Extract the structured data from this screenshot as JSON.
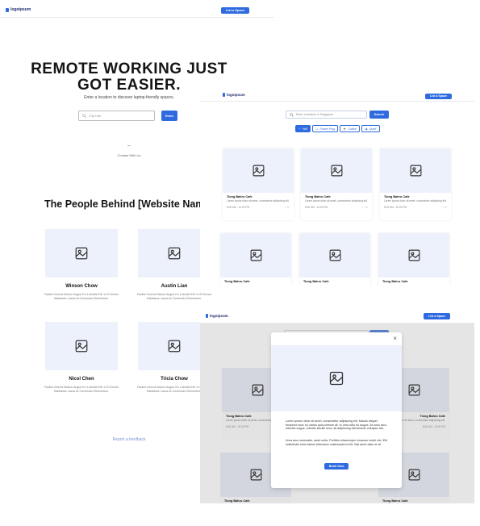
{
  "logo": {
    "text": "logoipsum",
    "suffix": "°"
  },
  "list_space_label": "List a Space",
  "landing": {
    "hero_line1": "REMOTE WORKING JUST",
    "hero_line2": "GOT EASIER.",
    "subtitle": "Enter a location to discover laptop-friendly spaces.",
    "city_placeholder": "City Hall",
    "enter_label": "Enter",
    "contact": "Contact With Us",
    "people_heading": "The People Behind [Website Name]",
    "team": [
      {
        "name": "Winson Chow",
        "desc": "Facilisi Viverra Dictum Augue Eu Lobortis Elit. In Et Donec Habitasse Lacus At Commodo Elementum."
      },
      {
        "name": "Austin Lian",
        "desc": "Facilisi Viverra Dictum Augue Eu Lobortis Elit. In Et Donec Habitasse Lacus At Commodo Elementum."
      },
      {
        "name": "Nicol Chen",
        "desc": "Facilisi Viverra Dictum Augue Eu Lobortis Elit. In Et Donec Habitasse Lacus At Commodo Elementum."
      },
      {
        "name": "Tricia Chow",
        "desc": "Facilisi Viverra Dictum Augue Eu Lobortis Elit. In Et Donec Habitasse Lacus At Commodo Elementum."
      }
    ],
    "feedback": "Report a feedback"
  },
  "search_page": {
    "placeholder": "Enter a location in Singapore",
    "search_label": "Search",
    "filters": [
      {
        "label": "Wifi",
        "icon": "wifi-icon",
        "active": true
      },
      {
        "label": "Power Plug",
        "icon": "plug-icon",
        "active": false
      },
      {
        "label": "Coffee",
        "icon": "coffee-icon",
        "active": false
      },
      {
        "label": "Quiet",
        "icon": "quiet-icon",
        "active": false
      }
    ],
    "cards": [
      {
        "title": "Tiong Bahru Cafe",
        "desc": "Lorem ipsum dolor sit amet, consectetur adipiscing elit.",
        "hours": "8:00 AM - 10:00 PM"
      },
      {
        "title": "Tiong Bahru Cafe",
        "desc": "Lorem ipsum dolor sit amet, consectetur adipiscing elit.",
        "hours": "8:00 AM - 10:00 PM"
      },
      {
        "title": "Tiong Bahru Cafe",
        "desc": "Lorem ipsum dolor sit amet, consectetur adipiscing elit.",
        "hours": "8:00 AM - 10:00 PM"
      },
      {
        "title": "Tiong Bahru Cafe"
      },
      {
        "title": "Tiong Bahru Cafe"
      },
      {
        "title": "Tiong Bahru Cafe"
      }
    ]
  },
  "modal_page": {
    "close": "×",
    "para1": "Lorem ipsum dolor sit amet, consectetur adipiscing elit. Mauris aliquet tincidunt nunc eu varius quis pretium sit. In urna odio eu augue. At nunc arcu ultricies augue, lobortis iaculis urna, sit adipiscing elementum volutpat. Aut.",
    "para2": "Urna arcu venenatis, amet nulla. Porttitor ullamcorper vivamus morbi nisi. Elit sollicitudin enim fames bibendum malesuada id elit. Nisi amet diam et at.",
    "book_label": "Book Now",
    "bg_cards": [
      {
        "title": "Tiong Bahru Cafe",
        "desc": "Lorem ipsum dolor sit amet, consectetur adipiscing elit.",
        "hours": "8:00 AM - 10:00 PM"
      },
      {
        "title": "Tiong Bahru Cafe",
        "desc": "Lorem ipsum dolor sit amet, consectetur adipiscing elit.",
        "hours": "8:00 AM - 10:00 PM"
      },
      {
        "title": "Tiong Bahru Cafe"
      },
      {
        "title": "Tiong Bahru Cafe"
      }
    ]
  },
  "colors": {
    "accent": "#2f6bdf",
    "placeholder_bg": "#edf1fb",
    "link": "#7d95d4"
  }
}
